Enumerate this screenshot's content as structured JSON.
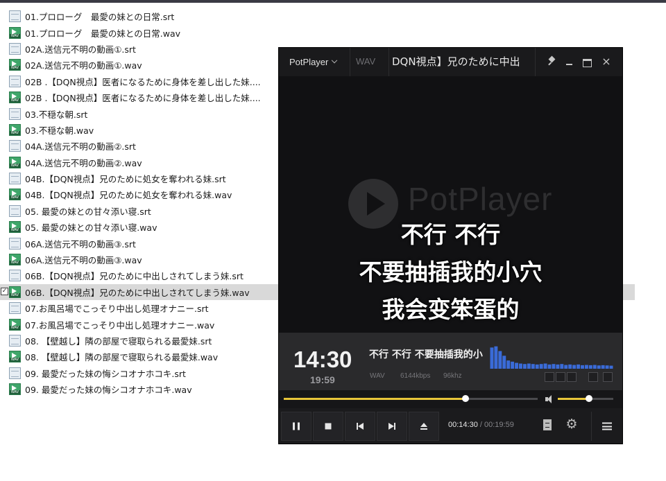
{
  "files": [
    {
      "name": "01.プロローグ　最愛の妹との日常.srt",
      "type": "srt"
    },
    {
      "name": "01.プロローグ　最愛の妹との日常.wav",
      "type": "wav"
    },
    {
      "name": "02A.送信元不明の動画①.srt",
      "type": "srt"
    },
    {
      "name": "02A.送信元不明の動画①.wav",
      "type": "wav"
    },
    {
      "name": "02B .【DQN視点】医者になるために身体を差し出した妹....",
      "type": "srt"
    },
    {
      "name": "02B .【DQN視点】医者になるために身体を差し出した妹....",
      "type": "wav"
    },
    {
      "name": "03.不穏な朝.srt",
      "type": "srt"
    },
    {
      "name": "03.不穏な朝.wav",
      "type": "wav"
    },
    {
      "name": "04A.送信元不明の動画②.srt",
      "type": "srt"
    },
    {
      "name": "04A.送信元不明の動画②.wav",
      "type": "wav"
    },
    {
      "name": "04B.【DQN視点】兄のために処女を奪われる妹.srt",
      "type": "srt"
    },
    {
      "name": "04B.【DQN視点】兄のために処女を奪われる妹.wav",
      "type": "wav"
    },
    {
      "name": "05. 最愛の妹との甘々添い寝.srt",
      "type": "srt"
    },
    {
      "name": "05. 最愛の妹との甘々添い寝.wav",
      "type": "wav"
    },
    {
      "name": "06A.送信元不明の動画③.srt",
      "type": "srt"
    },
    {
      "name": "06A.送信元不明の動画③.wav",
      "type": "wav"
    },
    {
      "name": "06B.【DQN視点】兄のために中出しされてしまう妹.srt",
      "type": "srt"
    },
    {
      "name": "06B.【DQN視点】兄のために中出しされてしまう妹.wav",
      "type": "wav"
    },
    {
      "name": "07.お風呂場でこっそり中出し処理オナニー.srt",
      "type": "srt"
    },
    {
      "name": "07.お風呂場でこっそり中出し処理オナニー.wav",
      "type": "wav"
    },
    {
      "name": "08. 【壁越し】隣の部屋で寝取られる最愛妹.srt",
      "type": "srt"
    },
    {
      "name": "08. 【壁越し】隣の部屋で寝取られる最愛妹.wav",
      "type": "wav"
    },
    {
      "name": "09. 最愛だった妹の悔シコオナホコキ.srt",
      "type": "srt"
    },
    {
      "name": "09. 最愛だった妹の悔シコオナホコキ.wav",
      "type": "wav"
    }
  ],
  "selected_index": 17,
  "player": {
    "brand": "PotPlayer",
    "format_tab": "WAV",
    "title": "DQN視点】兄のために中出",
    "watermark": "PotPlayer",
    "subtitle_lines": [
      "不行 不行",
      "不要抽插我的小穴",
      "我会变笨蛋的"
    ],
    "current_time_big": "14:30",
    "total_time_big": "19:59",
    "info_subtitle": "不行 不行 不要抽插我的小",
    "meta_format": "WAV",
    "meta_bitrate": "6144kbps",
    "meta_samplerate": "96khz",
    "seek_progress": 0.715,
    "volume_level": 0.56,
    "current_time": "00:14:30",
    "time_separator": "/",
    "total_time": "00:19:59",
    "eq_bars": [
      0.9,
      0.95,
      0.75,
      0.55,
      0.35,
      0.3,
      0.25,
      0.22,
      0.2,
      0.22,
      0.2,
      0.18,
      0.2,
      0.22,
      0.18,
      0.2,
      0.18,
      0.2,
      0.16,
      0.18,
      0.16,
      0.18,
      0.15,
      0.16,
      0.15,
      0.16,
      0.14,
      0.15,
      0.14,
      0.13
    ],
    "accent_color": "#e8c63a",
    "eq_color": "#3a6bd8"
  }
}
